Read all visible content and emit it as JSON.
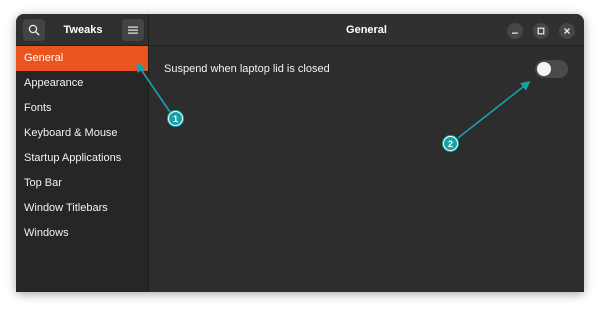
{
  "app": {
    "title": "Tweaks",
    "page_title": "General"
  },
  "header": {
    "search_icon": "search-icon",
    "menu_icon": "hamburger-menu-icon",
    "window_controls": [
      "minimize-icon",
      "maximize-icon",
      "close-icon"
    ]
  },
  "sidebar": {
    "items": [
      {
        "label": "General",
        "active": true
      },
      {
        "label": "Appearance",
        "active": false
      },
      {
        "label": "Fonts",
        "active": false
      },
      {
        "label": "Keyboard & Mouse",
        "active": false
      },
      {
        "label": "Startup Applications",
        "active": false
      },
      {
        "label": "Top Bar",
        "active": false
      },
      {
        "label": "Window Titlebars",
        "active": false
      },
      {
        "label": "Windows",
        "active": false
      }
    ]
  },
  "main": {
    "settings": [
      {
        "label": "Suspend when laptop lid is closed",
        "enabled": false
      }
    ]
  },
  "annotations": {
    "badges": [
      "1",
      "2"
    ],
    "color": "#17a2a8"
  },
  "colors": {
    "accent": "#e95420",
    "window_bg": "#2d2d2d",
    "sidebar_bg": "#262626"
  }
}
